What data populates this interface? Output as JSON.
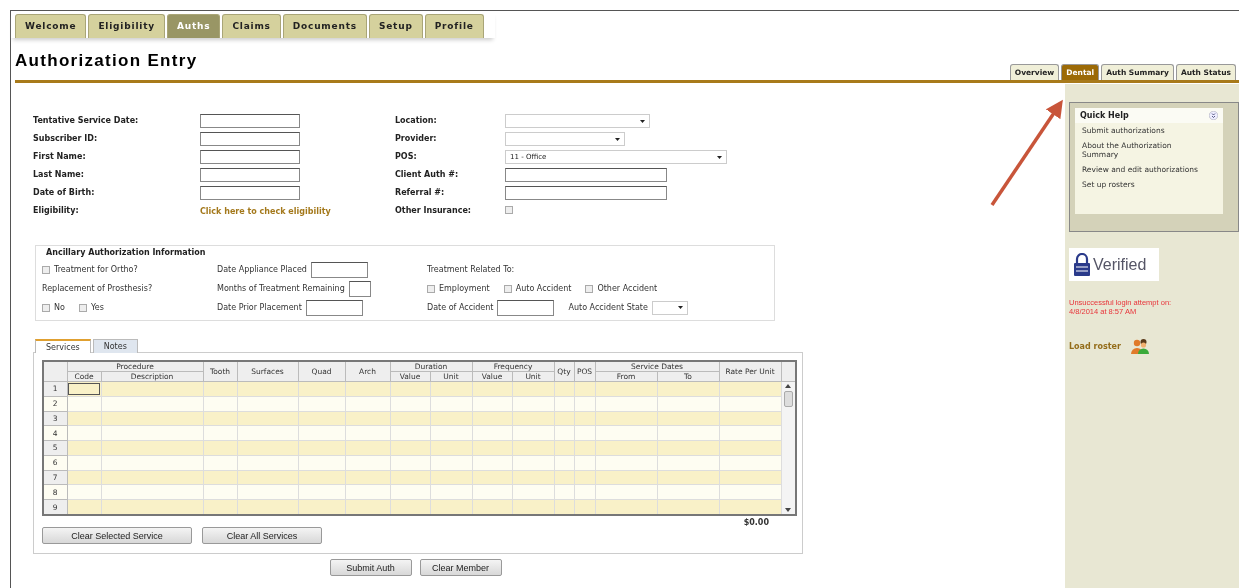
{
  "nav_tabs": [
    {
      "label": "Welcome",
      "selected": false
    },
    {
      "label": "Eligibility",
      "selected": false
    },
    {
      "label": "Auths",
      "selected": true
    },
    {
      "label": "Claims",
      "selected": false
    },
    {
      "label": "Documents",
      "selected": false
    },
    {
      "label": "Setup",
      "selected": false
    },
    {
      "label": "Profile",
      "selected": false
    }
  ],
  "page_title": "Authorization Entry",
  "view_tabs": [
    {
      "label": "Overview",
      "selected": false
    },
    {
      "label": "Dental",
      "selected": true
    },
    {
      "label": "Auth Summary",
      "selected": false
    },
    {
      "label": "Auth Status",
      "selected": false
    }
  ],
  "member_form": {
    "rows": [
      {
        "left": {
          "label": "Tentative Service Date:",
          "kind": "input"
        },
        "right": {
          "label": "Location:",
          "kind": "select"
        }
      },
      {
        "left": {
          "label": "Subscriber ID:",
          "kind": "input"
        },
        "right": {
          "label": "Provider:",
          "kind": "select"
        }
      },
      {
        "left": {
          "label": "First Name:",
          "kind": "input"
        },
        "right": {
          "label": "POS:",
          "kind": "select",
          "value": "11 - Office"
        }
      },
      {
        "left": {
          "label": "Last Name:",
          "kind": "input"
        },
        "right": {
          "label": "Client Auth #:",
          "kind": "input"
        }
      },
      {
        "left": {
          "label": "Date of Birth:",
          "kind": "input"
        },
        "right": {
          "label": "Referral #:",
          "kind": "input"
        }
      },
      {
        "left": {
          "label": "Eligibility:",
          "kind": "link",
          "text": "Click here to check eligibility"
        },
        "right": {
          "label": "Other Insurance:",
          "kind": "checkbox",
          "checked": false
        }
      }
    ]
  },
  "ancillary": {
    "title": "Ancillary Authorization Information",
    "rows": [
      [
        [
          {
            "kind": "checkbox",
            "label": "Treatment for Ortho?",
            "checked": false
          }
        ],
        [
          {
            "kind": "input",
            "label": "Date Appliance Placed"
          }
        ],
        [
          {
            "kind": "label",
            "label": "Treatment Related To:"
          }
        ]
      ],
      [
        [
          {
            "kind": "label",
            "label": "Replacement of Prosthesis?"
          }
        ],
        [
          {
            "kind": "short_input",
            "label": "Months of Treatment Remaining"
          }
        ],
        [
          {
            "kind": "checkbox",
            "label": "Employment",
            "checked": false
          },
          {
            "kind": "checkbox",
            "label": "Auto Accident",
            "checked": false
          },
          {
            "kind": "checkbox",
            "label": "Other Accident",
            "checked": false
          }
        ]
      ],
      [
        [
          {
            "kind": "checkbox",
            "label": "No",
            "checked": false
          },
          {
            "kind": "checkbox",
            "label": "Yes",
            "checked": false
          }
        ],
        [
          {
            "kind": "input",
            "label": "Date Prior Placement"
          }
        ],
        [
          {
            "kind": "input",
            "label": "Date of Accident"
          },
          {
            "kind": "select",
            "label": "Auto Accident State"
          }
        ]
      ]
    ]
  },
  "service_tabs": [
    {
      "label": "Services",
      "selected": true
    },
    {
      "label": "Notes",
      "selected": false
    }
  ],
  "services_table": {
    "columns": [
      {
        "label": "Procedure",
        "sub": [
          "Code",
          "Description"
        ]
      },
      {
        "label": "Tooth"
      },
      {
        "label": "Surfaces"
      },
      {
        "label": "Quad"
      },
      {
        "label": "Arch"
      },
      {
        "label": "Duration",
        "sub": [
          "Value",
          "Unit"
        ]
      },
      {
        "label": "Frequency",
        "sub": [
          "Value",
          "Unit"
        ]
      },
      {
        "label": "Qty"
      },
      {
        "label": "POS"
      },
      {
        "label": "Service Dates",
        "sub": [
          "From",
          "To"
        ]
      },
      {
        "label": "Rate Per Unit"
      }
    ],
    "rows": [
      {
        "number": "1",
        "focused": true
      },
      {
        "number": "2",
        "focused": false
      },
      {
        "number": "3",
        "focused": false
      },
      {
        "number": "4",
        "focused": false
      },
      {
        "number": "5",
        "focused": false
      },
      {
        "number": "6",
        "focused": false
      },
      {
        "number": "7",
        "focused": false
      },
      {
        "number": "8",
        "focused": false
      },
      {
        "number": "9",
        "focused": false
      }
    ],
    "total": "$0.00",
    "buttons": [
      "Clear Selected Service",
      "Clear All Services"
    ]
  },
  "form_buttons": [
    "Submit Auth",
    "Clear Member"
  ],
  "sidebar": {
    "quick_help": {
      "title": "Quick Help",
      "links": [
        "Submit authorizations",
        "About the Authorization Summary",
        "Review and edit authorizations",
        "Set up rosters"
      ]
    },
    "badge": "Verified",
    "login_notice": "Unsuccessful login attempt on: 4/8/2014 at 8:57 AM",
    "load_roster": "Load roster"
  }
}
